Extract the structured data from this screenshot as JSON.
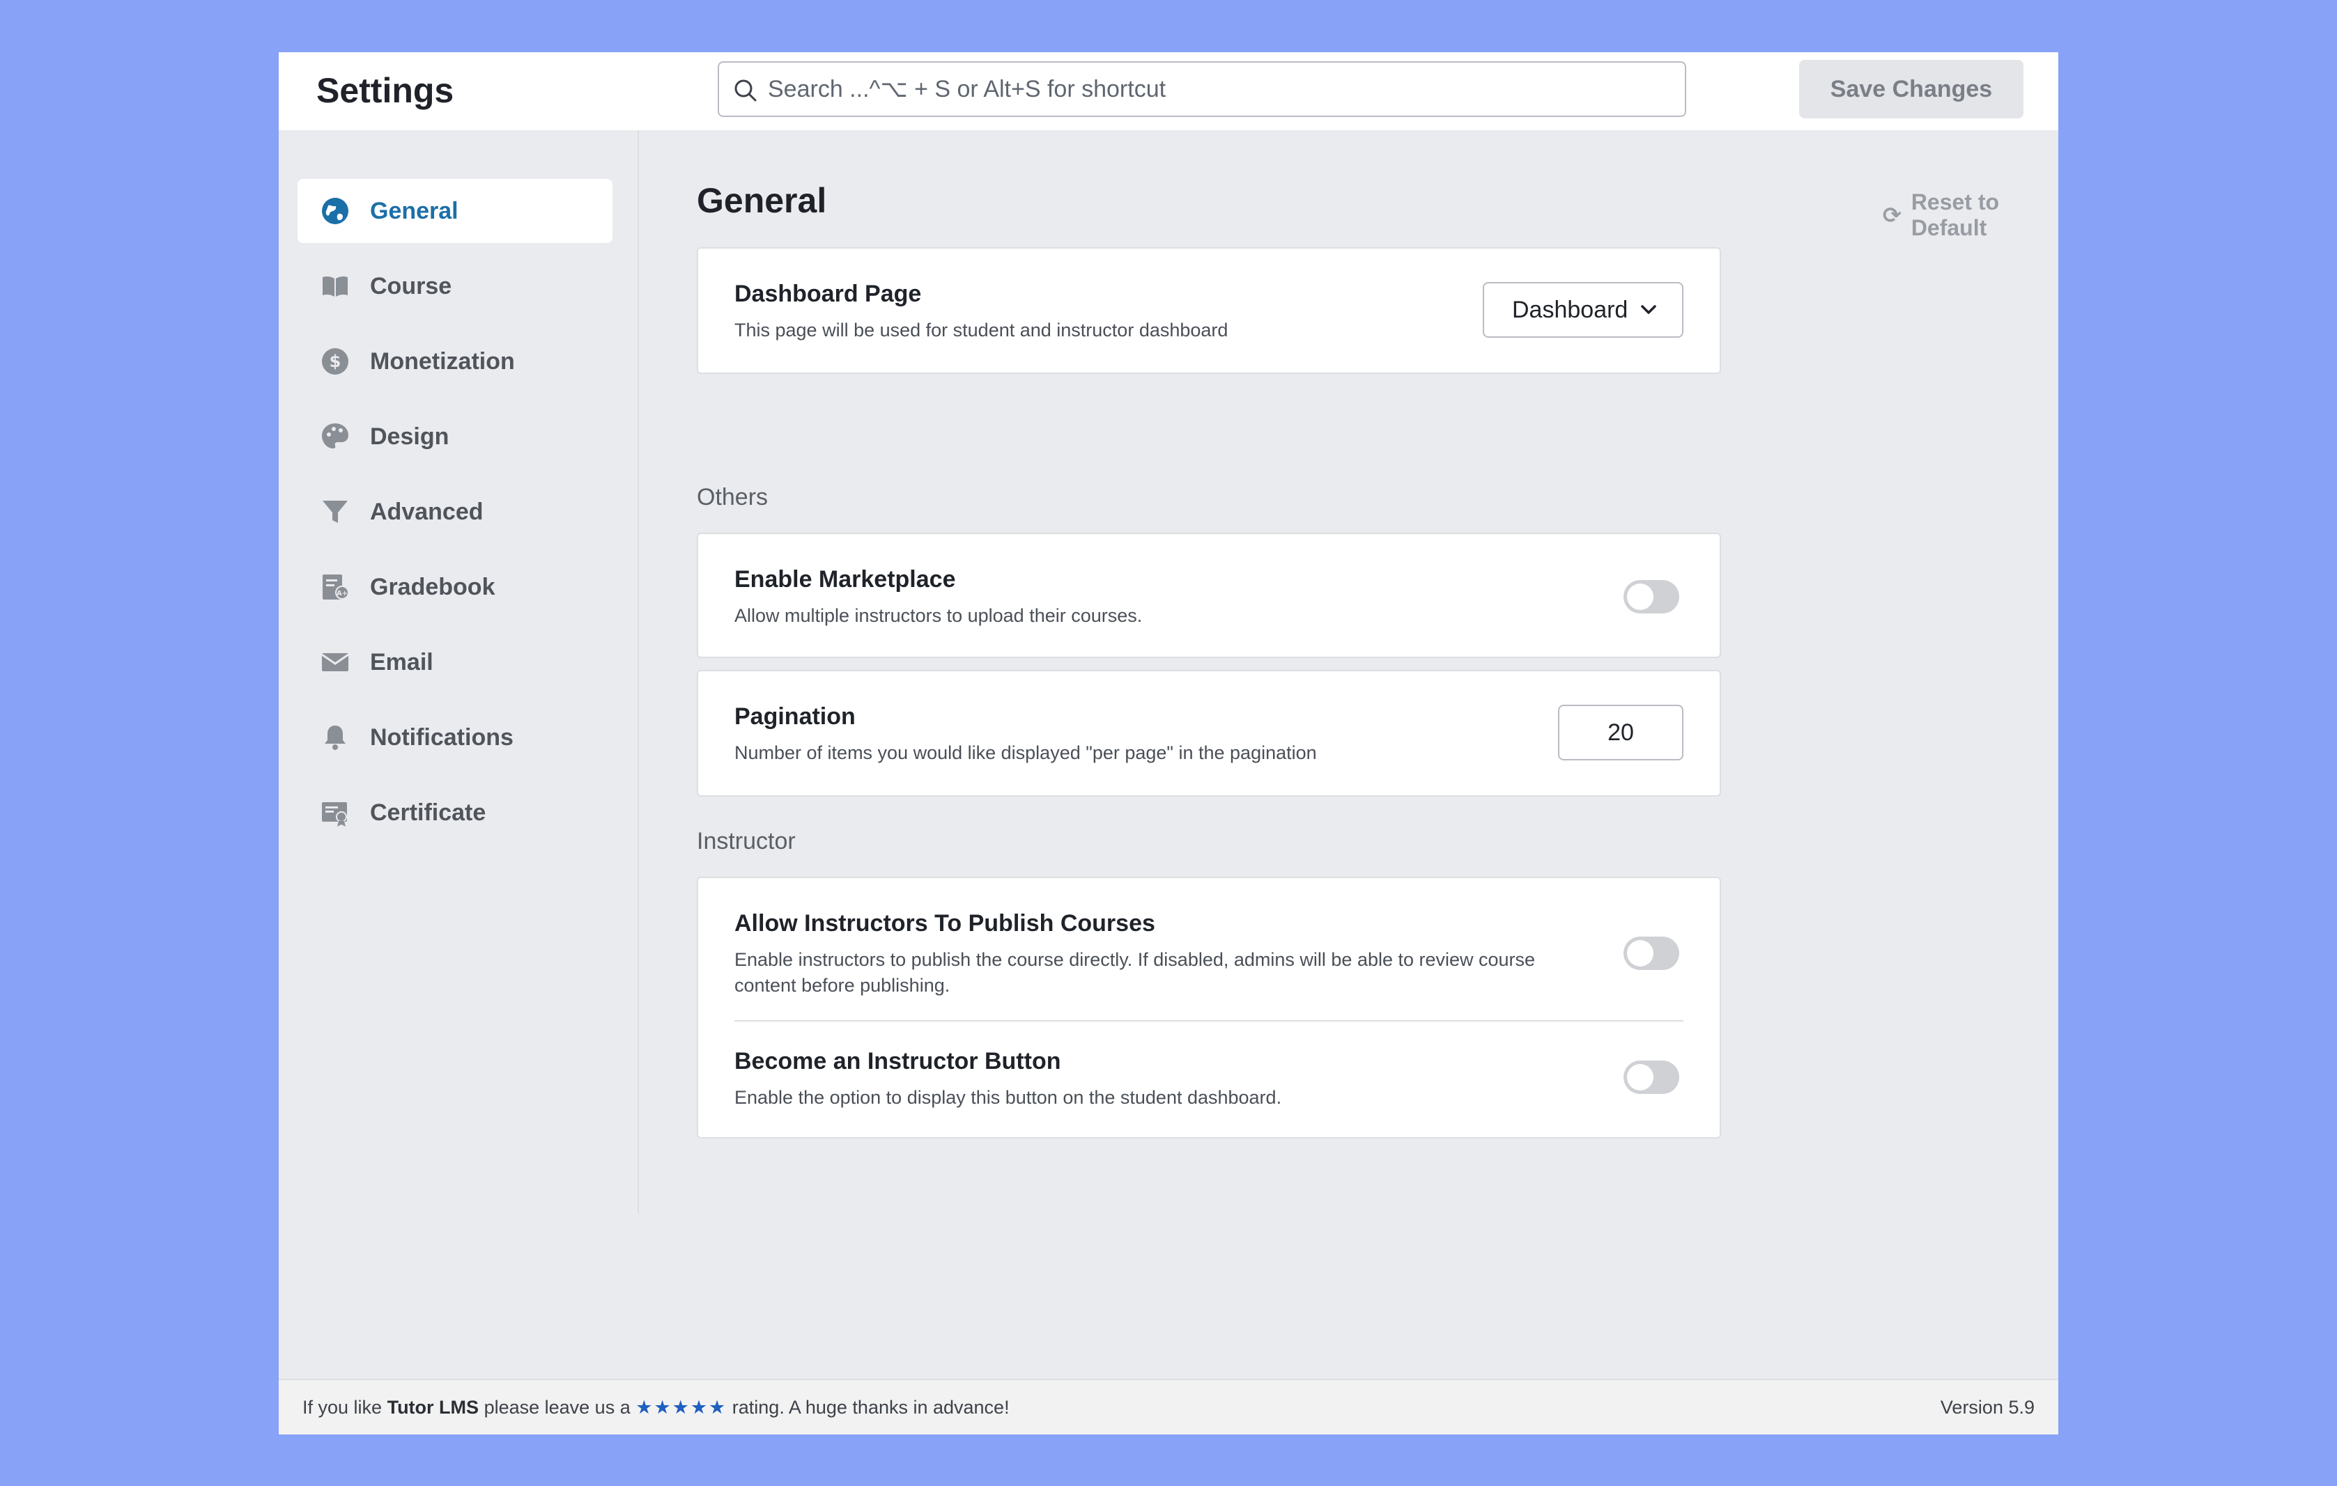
{
  "header": {
    "title": "Settings",
    "search_placeholder": "Search ...^⌥ + S or Alt+S for shortcut",
    "save_label": "Save Changes"
  },
  "sidebar": {
    "items": [
      {
        "label": "General",
        "icon": "globe-icon",
        "active": true
      },
      {
        "label": "Course",
        "icon": "book-icon"
      },
      {
        "label": "Monetization",
        "icon": "dollar-badge-icon"
      },
      {
        "label": "Design",
        "icon": "palette-icon"
      },
      {
        "label": "Advanced",
        "icon": "filter-icon"
      },
      {
        "label": "Gradebook",
        "icon": "gradebook-icon"
      },
      {
        "label": "Email",
        "icon": "envelope-icon"
      },
      {
        "label": "Notifications",
        "icon": "bell-icon"
      },
      {
        "label": "Certificate",
        "icon": "certificate-icon"
      }
    ]
  },
  "main": {
    "title": "General",
    "reset_label": "Reset to Default",
    "dashboard": {
      "title": "Dashboard Page",
      "desc": "This page will be used for student and instructor dashboard",
      "selected": "Dashboard"
    },
    "others_label": "Others",
    "marketplace": {
      "title": "Enable Marketplace",
      "desc": "Allow multiple instructors to upload their courses.",
      "enabled": false
    },
    "pagination": {
      "title": "Pagination",
      "desc": "Number of items you would like displayed \"per page\" in the pagination",
      "value": "20"
    },
    "instructor_label": "Instructor",
    "publish": {
      "title": "Allow Instructors To Publish Courses",
      "desc": "Enable instructors to publish the course directly. If disabled, admins will be able to review course content before publishing.",
      "enabled": false
    },
    "become": {
      "title": "Become an Instructor Button",
      "desc": "Enable the option to display this button on the student dashboard.",
      "enabled": false
    }
  },
  "footer": {
    "text_pre": "If you like",
    "brand": "Tutor LMS",
    "text_mid": "please leave us a",
    "stars": "★★★★★",
    "text_post": "rating. A huge thanks in advance!",
    "version": "Version 5.9"
  },
  "colors": {
    "background": "#87a2f7",
    "accent": "#1b6fa8",
    "panel": "#eaebee"
  }
}
